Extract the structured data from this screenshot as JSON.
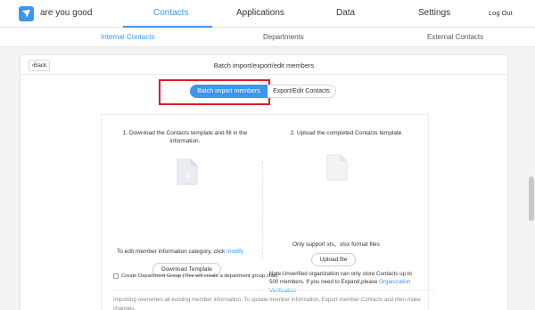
{
  "app": {
    "org_name": "are you good",
    "logout": "Log Out"
  },
  "nav": {
    "tabs": [
      {
        "label": "Contacts",
        "active": true
      },
      {
        "label": "Applications",
        "active": false
      },
      {
        "label": "Data",
        "active": false
      },
      {
        "label": "Settings",
        "active": false
      }
    ]
  },
  "subnav": {
    "items": [
      {
        "label": "Internal Contacts",
        "active": true
      },
      {
        "label": "Departments",
        "active": false
      },
      {
        "label": "External Contacts",
        "active": false
      }
    ]
  },
  "page": {
    "back_label": "Back",
    "title": "Batch import/export/edit members",
    "tabs": {
      "import_label": "Batch import members",
      "export_label": "Export/Edit Contacts"
    }
  },
  "step1": {
    "text": "1. Download the Contacts template and fill in the information.",
    "hint_prefix": "To edit member information category, click",
    "hint_link": "modify",
    "button": "Download Template"
  },
  "step2": {
    "text": "2. Upload the completed Contacts template.",
    "formats": "Only support xls、xlsx format files",
    "button": "Upload file",
    "note": "Note:Unverified organization can only store Contacts up to 500 members. If you need to Expand,please",
    "note_link": "Organization Verification"
  },
  "options": {
    "dept_group_label": "Create Department Group (This will create a department group chat)"
  },
  "footer": {
    "note": "Importing overwrites all existing member information. To update member information, Export member Contacts and then make changes."
  },
  "colors": {
    "accent": "#3d95f0",
    "highlight": "#e0182d"
  },
  "icons": {
    "logo": "bird-logo-icon",
    "excel_file": "excel-file-icon",
    "blank_file": "file-icon"
  }
}
